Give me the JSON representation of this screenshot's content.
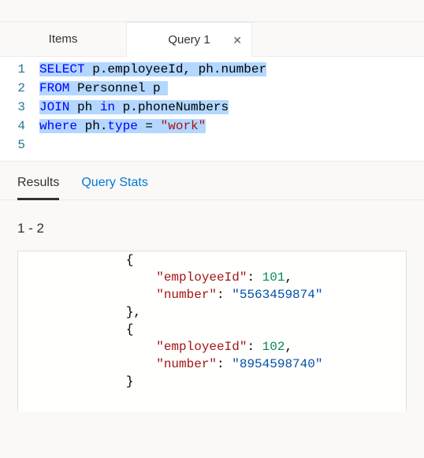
{
  "tabs": {
    "items_label": "Items",
    "query_label": "Query 1"
  },
  "editor": {
    "lines": [
      "1",
      "2",
      "3",
      "4",
      "5"
    ],
    "l1_select": "SELECT",
    "l1_rest": " p.employeeId, ph.number",
    "l2_from": "FROM",
    "l2_rest": " Personnel p",
    "l3_join": "JOIN",
    "l3_mid": " ph ",
    "l3_in": "in",
    "l3_rest": " p.phoneNumbers",
    "l4_where": "where",
    "l4_mid": " ph.",
    "l4_type": "type",
    "l4_eq": " = ",
    "l4_str": "\"work\""
  },
  "subtabs": {
    "results": "Results",
    "stats": "Query Stats"
  },
  "results_count": "1 - 2",
  "json": {
    "open1": "{",
    "k_employee": "\"employeeId\"",
    "v_emp1": "101",
    "k_number": "\"number\"",
    "v_num1": "\"5563459874\"",
    "close1": "},",
    "open2": "{",
    "v_emp2": "102",
    "v_num2": "\"8954598740\"",
    "close2": "}",
    "colon": ": ",
    "comma": ","
  }
}
